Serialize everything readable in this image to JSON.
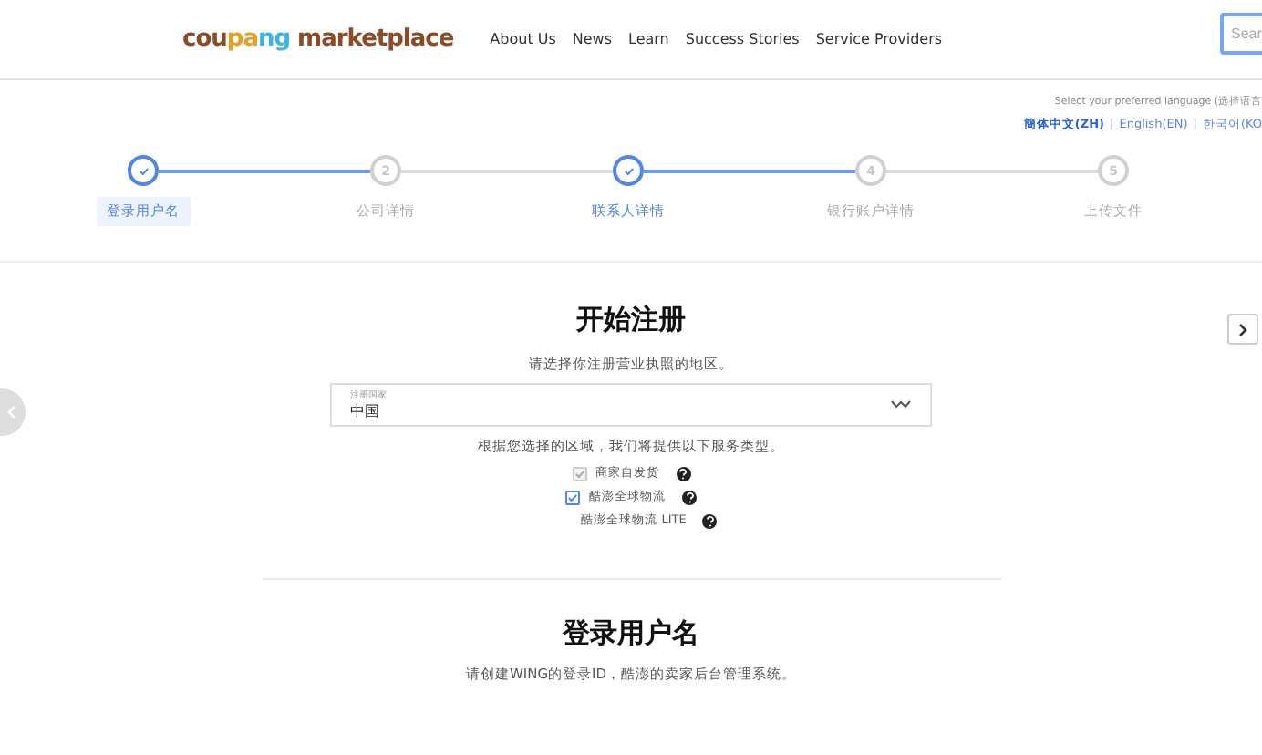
{
  "header": {
    "logo": {
      "part1": "coupang",
      "part2": "marketplace"
    },
    "nav": [
      "About Us",
      "News",
      "Learn",
      "Success Stories",
      "Service Providers"
    ],
    "search": {
      "placeholder": "Sear"
    }
  },
  "language": {
    "prompt": "Select your preferred language (选择语言",
    "separator": "|",
    "options": [
      {
        "label": "簡体中文(ZH)",
        "selected": true
      },
      {
        "label": "English(EN)",
        "selected": false
      },
      {
        "label": "한국어(KO",
        "selected": false
      }
    ]
  },
  "steps": [
    {
      "label": "登录用户名",
      "done": true,
      "current": true
    },
    {
      "label": "公司详情",
      "number": "2",
      "done": false,
      "current": false
    },
    {
      "label": "联系人详情",
      "done": true,
      "current": false
    },
    {
      "label": "银行账户详情",
      "number": "4",
      "done": false,
      "current": false
    },
    {
      "label": "上传文件",
      "number": "5",
      "done": false,
      "current": false
    }
  ],
  "registration": {
    "title": "开始注册",
    "subtitle": "请选择你注册营业执照的地区。",
    "country_select": {
      "label": "注册国家",
      "value": "中国"
    },
    "service_note": "根据您选择的区域，我们将提供以下服务类型。",
    "services": [
      {
        "kind": "checkbox",
        "label": "商家自发货",
        "checked": true,
        "disabled": true
      },
      {
        "kind": "checkbox",
        "label": "酷澎全球物流",
        "checked": true,
        "disabled": false
      },
      {
        "kind": "plain",
        "label": "酷澎全球物流 LITE"
      }
    ]
  },
  "login_section": {
    "title": "登录用户名",
    "description": "请创建WING的登录ID，酷澎的卖家后台管理系统。"
  }
}
